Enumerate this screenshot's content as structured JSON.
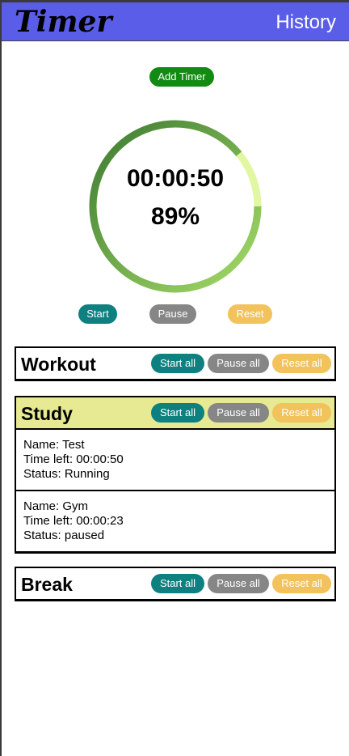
{
  "header": {
    "title": "Timer",
    "history_label": "History"
  },
  "add_timer_label": "Add Timer",
  "current_timer": {
    "time_left": "00:00:50",
    "percent_label": "89%",
    "progress_fraction": 0.89
  },
  "controls": {
    "start": "Start",
    "pause": "Pause",
    "reset": "Reset"
  },
  "group_buttons": {
    "start_all": "Start all",
    "pause_all": "Pause all",
    "reset_all": "Reset all"
  },
  "groups": [
    {
      "name": "Workout",
      "timers": []
    },
    {
      "name": "Study",
      "timers": [
        {
          "name_line": "Name: Test",
          "time_line": "Time left: 00:00:50",
          "status_line": "Status: Running"
        },
        {
          "name_line": "Name: Gym",
          "time_line": "Time left: 00:00:23",
          "status_line": "Status: paused"
        }
      ]
    },
    {
      "name": "Break",
      "timers": []
    }
  ],
  "colors": {
    "header_bg": "#5a5de8",
    "add_timer_bg": "#138a13",
    "start_bg": "#0e8080",
    "pause_bg": "#868686",
    "reset_bg": "#f2c25c",
    "study_highlight": "#e7e993",
    "ring_dark": "#3d7a32",
    "ring_light": "#a6dc6a",
    "ring_remaining": "#e2f7a2"
  }
}
